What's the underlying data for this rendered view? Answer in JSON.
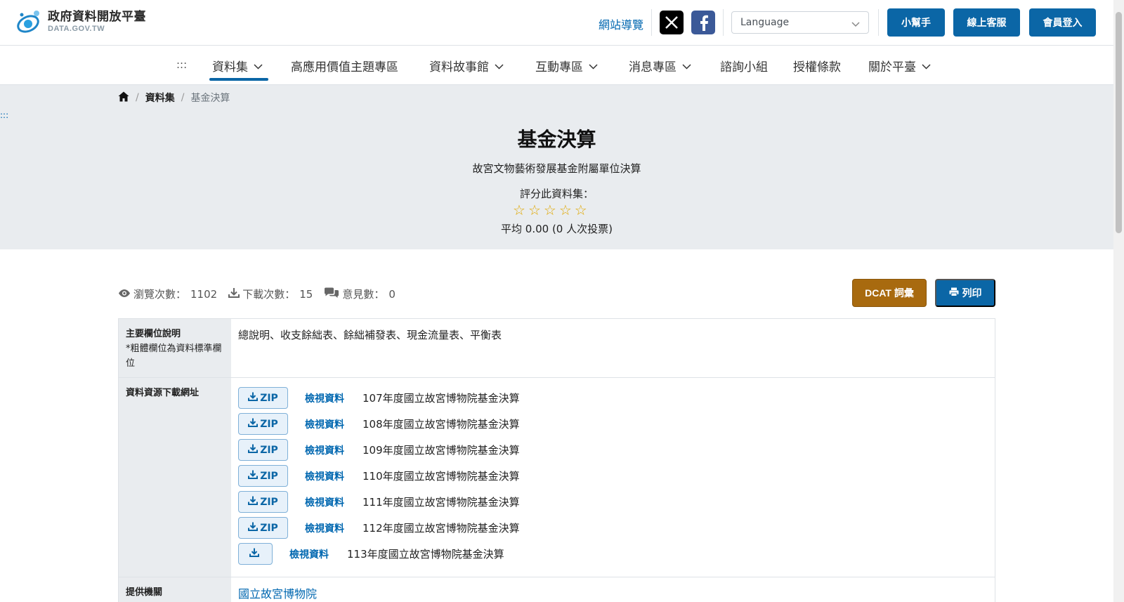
{
  "header": {
    "logo_title": "政府資料開放平臺",
    "logo_sub": "DATA.GOV.TW",
    "sitemap_label": "網站導覽",
    "language_placeholder": "Language",
    "helper_label": "小幫手",
    "service_label": "線上客服",
    "login_label": "會員登入",
    "brand_color": "#0b66a6"
  },
  "nav": {
    "accesskey": ":::",
    "items": [
      {
        "label": "資料集",
        "dropdown": true,
        "active": true
      },
      {
        "label": "高應用價值主題專區",
        "dropdown": false
      },
      {
        "label": "資料故事館",
        "dropdown": true
      },
      {
        "label": "互動專區",
        "dropdown": true
      },
      {
        "label": "消息專區",
        "dropdown": true
      },
      {
        "label": "諮詢小組",
        "dropdown": false
      },
      {
        "label": "授權條款",
        "dropdown": false
      },
      {
        "label": "關於平臺",
        "dropdown": true
      }
    ]
  },
  "breadcrumb": {
    "home_icon": "home-icon",
    "level1": "資料集",
    "current": "基金決算"
  },
  "hero": {
    "accesskey": ":::",
    "title": "基金決算",
    "subtitle": "故宮文物藝術發展基金附屬單位決算",
    "rate_label": "評分此資料集：",
    "stars_total": 5,
    "stars_filled": 0,
    "average_text": "平均 0.00 (0 人次投票)"
  },
  "stats": {
    "views_label": "瀏覽次數：",
    "views_value": "1102",
    "downloads_label": "下載次數：",
    "downloads_value": "15",
    "comments_label": "意見數：",
    "comments_value": "0"
  },
  "actions": {
    "dcat_label": "DCAT 詞彙",
    "print_label": "列印",
    "dcat_color": "#a86a0f"
  },
  "table": {
    "fields_label": "主要欄位說明",
    "fields_note": "*粗體欄位為資料標準欄位",
    "fields_value": "總說明、收支餘絀表、餘絀補發表、現金流量表、平衡表",
    "resources_label": "資料資源下載網址",
    "view_label": "檢視資料",
    "zip_label": "ZIP",
    "resources": [
      {
        "format": "ZIP",
        "name": "107年度國立故宮博物院基金決算"
      },
      {
        "format": "ZIP",
        "name": "108年度國立故宮博物院基金決算"
      },
      {
        "format": "ZIP",
        "name": "109年度國立故宮博物院基金決算"
      },
      {
        "format": "ZIP",
        "name": "110年度國立故宮博物院基金決算"
      },
      {
        "format": "ZIP",
        "name": "111年度國立故宮博物院基金決算"
      },
      {
        "format": "ZIP",
        "name": "112年度國立故宮博物院基金決算"
      },
      {
        "format": "",
        "name": "113年度國立故宮博物院基金決算"
      }
    ],
    "provider_label": "提供機關",
    "provider_value": "國立故宮博物院"
  }
}
